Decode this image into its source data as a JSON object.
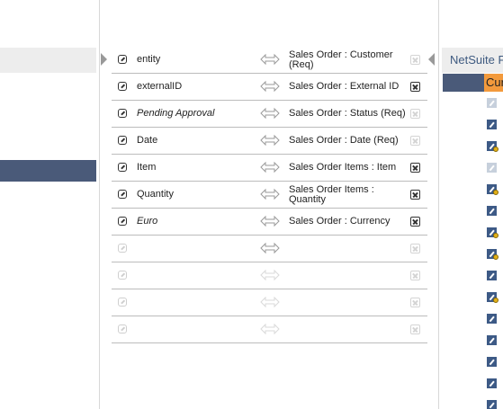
{
  "right_pane": {
    "title": "NetSuite F",
    "selected_label": "Cur",
    "field_icons": [
      {
        "tone": "light",
        "lock": false
      },
      {
        "tone": "dark",
        "lock": false
      },
      {
        "tone": "dark",
        "lock": true
      },
      {
        "tone": "light",
        "lock": false
      },
      {
        "tone": "dark",
        "lock": true
      },
      {
        "tone": "dark",
        "lock": false
      },
      {
        "tone": "dark",
        "lock": true
      },
      {
        "tone": "dark",
        "lock": true
      },
      {
        "tone": "dark",
        "lock": false
      },
      {
        "tone": "dark",
        "lock": true
      },
      {
        "tone": "dark",
        "lock": false
      },
      {
        "tone": "dark",
        "lock": false
      },
      {
        "tone": "dark",
        "lock": false
      },
      {
        "tone": "dark",
        "lock": false
      },
      {
        "tone": "dark",
        "lock": false
      }
    ]
  },
  "mappings": [
    {
      "source": "entity",
      "source_italic": false,
      "destination": "Sales Order : Customer (Req)",
      "removable": false
    },
    {
      "source": "externalID",
      "source_italic": false,
      "destination": "Sales Order : External ID",
      "removable": true
    },
    {
      "source": "Pending Approval",
      "source_italic": true,
      "destination": "Sales Order : Status (Req)",
      "removable": false
    },
    {
      "source": "Date",
      "source_italic": false,
      "destination": "Sales Order : Date (Req)",
      "removable": false
    },
    {
      "source": "Item",
      "source_italic": false,
      "destination": "Sales Order Items : Item",
      "removable": true
    },
    {
      "source": "Quantity",
      "source_italic": false,
      "destination": "Sales Order Items : Quantity",
      "removable": true
    },
    {
      "source": "Euro",
      "source_italic": true,
      "destination": "Sales Order : Currency",
      "removable": true
    },
    {
      "source": "",
      "source_italic": false,
      "destination": "",
      "removable": false,
      "arrow_dark": true
    },
    {
      "source": "",
      "source_italic": false,
      "destination": "",
      "removable": false
    },
    {
      "source": "",
      "source_italic": false,
      "destination": "",
      "removable": false
    },
    {
      "source": "",
      "source_italic": false,
      "destination": "",
      "removable": false
    }
  ],
  "colors": {
    "nav_selected": "#4a5a79",
    "accent_orange": "#f39a3c",
    "title_blue": "#3e5a80"
  }
}
